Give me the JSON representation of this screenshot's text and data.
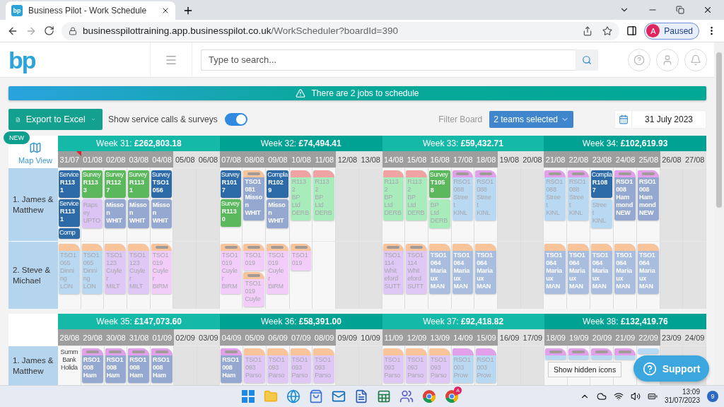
{
  "browser": {
    "tab_title": "Business Pilot - Work Schedule",
    "favicon": "bp",
    "url_host": "businesspilottraining.app.businesspilot.co.uk",
    "url_path": "/WorkScheduler?boardId=390",
    "profile_initial": "A",
    "profile_status": "Paused"
  },
  "header": {
    "logo": "bp",
    "search_placeholder": "Type to search..."
  },
  "banner": {
    "text": "There are 2 jobs to schedule"
  },
  "toolbar": {
    "export_label": "Export to Excel",
    "toggle_label": "Show service calls & surveys",
    "toggle_on": true,
    "filter_label": "Filter Board",
    "filter_value": "2 teams selected",
    "date_value": "31 July 2023"
  },
  "map_view": {
    "badge": "NEW",
    "label": "Map View"
  },
  "blocks": [
    {
      "weeks": [
        {
          "title": "Week 31: **£262,803.18**",
          "days": [
            {
              "date": "31/07",
              "weekend": false,
              "flag": true
            },
            {
              "date": "01/08",
              "weekend": false
            },
            {
              "date": "02/08",
              "weekend": false
            },
            {
              "date": "03/08",
              "weekend": false
            },
            {
              "date": "04/08",
              "weekend": false
            },
            {
              "date": "05/08",
              "weekend": true
            },
            {
              "date": "06/08",
              "weekend": true
            }
          ]
        },
        {
          "title": "Week 32: **£74,494.41**",
          "days": [
            {
              "date": "07/08",
              "weekend": false
            },
            {
              "date": "08/08",
              "weekend": false
            },
            {
              "date": "09/08",
              "weekend": false
            },
            {
              "date": "10/08",
              "weekend": false
            },
            {
              "date": "11/08",
              "weekend": false
            },
            {
              "date": "12/08",
              "weekend": true
            },
            {
              "date": "13/08",
              "weekend": true
            }
          ]
        },
        {
          "title": "Week 33: **£59,432.71**",
          "days": [
            {
              "date": "14/08",
              "weekend": false
            },
            {
              "date": "15/08",
              "weekend": false
            },
            {
              "date": "16/08",
              "weekend": false
            },
            {
              "date": "17/08",
              "weekend": false
            },
            {
              "date": "18/08",
              "weekend": false
            },
            {
              "date": "19/08",
              "weekend": true
            },
            {
              "date": "20/08",
              "weekend": true
            }
          ]
        },
        {
          "title": "Week 34: **£102,619.93**",
          "days": [
            {
              "date": "21/08",
              "weekend": false
            },
            {
              "date": "22/08",
              "weekend": false
            },
            {
              "date": "23/08",
              "weekend": false
            },
            {
              "date": "24/08",
              "weekend": false
            },
            {
              "date": "25/08",
              "weekend": false
            },
            {
              "date": "26/08",
              "weekend": true
            },
            {
              "date": "27/08",
              "weekend": true
            }
          ]
        }
      ],
      "teams": [
        {
          "name": "1. James & Matthew",
          "cells": [
            [
              {
                "kind": "label",
                "color": "#2d6aa8",
                "lines": [
                  "Service",
                  "R113",
                  "1"
                ]
              },
              {
                "kind": "label",
                "color": "#2d6aa8",
                "lines": [
                  "Service",
                  "R113",
                  "1"
                ]
              },
              {
                "kind": "label",
                "color": "#2d6aa8",
                "lines": [
                  "Comp"
                ]
              }
            ],
            [
              {
                "kind": "label",
                "color": "#5cb85c",
                "lines": [
                  "Survey",
                  "R113",
                  "3"
                ]
              },
              {
                "kind": "plain",
                "color": "#dcc4f4",
                "bold": false,
                "lines": [
                  "Raps",
                  "ey",
                  "UPTO"
                ]
              }
            ],
            [
              {
                "kind": "label",
                "color": "#5cb85c",
                "lines": [
                  "Survey",
                  "R112",
                  "7"
                ]
              },
              {
                "kind": "plain",
                "color": "#95a8cf",
                "bold": true,
                "lines": [
                  "Misso",
                  "n",
                  "WHIT"
                ]
              }
            ],
            [
              {
                "kind": "label",
                "color": "#5cb85c",
                "lines": [
                  "Survey",
                  "R113",
                  "1"
                ]
              },
              {
                "kind": "plain",
                "color": "#95a8cf",
                "bold": true,
                "lines": [
                  "Misso",
                  "n",
                  "WHIT"
                ]
              }
            ],
            [
              {
                "kind": "label",
                "color": "#2d6aa8",
                "lines": [
                  "Survey",
                  "TSO1",
                  "056"
                ]
              },
              {
                "kind": "plain",
                "color": "#95a8cf",
                "bold": true,
                "lines": [
                  "Misso",
                  "n",
                  "WHIT"
                ]
              }
            ],
            [],
            [],
            [
              {
                "kind": "label",
                "color": "#2d6aa8",
                "lines": [
                  "Survey",
                  "R101",
                  "7"
                ]
              },
              {
                "kind": "label",
                "color": "#5cb85c",
                "lines": [
                  "Survey",
                  "R113",
                  "0"
                ]
              }
            ],
            [
              {
                "kind": "tab",
                "tab": {
                  "color": "#f9c49a",
                  "handle": true
                },
                "color": "#95a8cf",
                "bold": true,
                "lines": [
                  "TSO1",
                  "081",
                  "Misso",
                  "n",
                  "WHIT"
                ]
              }
            ],
            [
              {
                "kind": "label",
                "color": "#2d6aa8",
                "lines": [
                  "Compla",
                  "R102",
                  "9"
                ]
              },
              {
                "kind": "plain",
                "color": "#95a8cf",
                "bold": true,
                "lines": [
                  "Misso",
                  "n",
                  "WHIT"
                ]
              }
            ],
            [
              {
                "kind": "tab",
                "tab": {
                  "color": "#f0a3a3",
                  "handle": false
                },
                "color": "#a9ecbb",
                "bold": false,
                "lines": [
                  "R113",
                  "2",
                  "BP",
                  "Ltd",
                  "DERB"
                ]
              }
            ],
            [
              {
                "kind": "tab",
                "tab": {
                  "color": "#f0a3a3",
                  "handle": false
                },
                "color": "#a9ecbb",
                "bold": false,
                "lines": [
                  "R113",
                  "2",
                  "BP",
                  "Ltd",
                  "DERB"
                ]
              }
            ],
            [],
            [],
            [
              {
                "kind": "tab",
                "tab": {
                  "color": "#f0a3a3",
                  "handle": false
                },
                "color": "#a9ecbb",
                "bold": false,
                "lines": [
                  "R113",
                  "2",
                  "BP",
                  "Ltd",
                  "DERB"
                ]
              }
            ],
            [
              {
                "kind": "tab",
                "tab": {
                  "color": "#f0a3a3",
                  "handle": false
                },
                "color": "#a9ecbb",
                "bold": false,
                "lines": [
                  "R113",
                  "2",
                  "BP",
                  "Ltd",
                  "DERB"
                ]
              }
            ],
            [
              {
                "kind": "label",
                "color": "#5cb85c",
                "lines": [
                  "Survey",
                  "T105",
                  "8"
                ]
              },
              {
                "kind": "plain",
                "color": "#a9ecbb",
                "bold": false,
                "lines": [
                  "BP",
                  "Ltd",
                  "DERB"
                ]
              }
            ],
            [
              {
                "kind": "tab",
                "tab": {
                  "color": "#e3a0ea",
                  "handle": true
                },
                "color": "#b9d9f2",
                "bold": false,
                "lines": [
                  "RSO1",
                  "088",
                  "Stree",
                  "t",
                  "KINL"
                ]
              }
            ],
            [
              {
                "kind": "tab",
                "tab": {
                  "color": "#e3a0ea",
                  "handle": true
                },
                "color": "#b9d9f2",
                "bold": false,
                "lines": [
                  "RSO1",
                  "088",
                  "Stree",
                  "t",
                  "KINL"
                ]
              }
            ],
            [],
            [],
            [
              {
                "kind": "tab",
                "tab": {
                  "color": "#e3a0ea",
                  "handle": true
                },
                "color": "#b9d9f2",
                "bold": false,
                "lines": [
                  "RSO1",
                  "088",
                  "Stree",
                  "t",
                  "KINL"
                ]
              }
            ],
            [
              {
                "kind": "tab",
                "tab": {
                  "color": "#e3a0ea",
                  "handle": true
                },
                "color": "#b9d9f2",
                "bold": false,
                "lines": [
                  "RSO1",
                  "088",
                  "Stree",
                  "t",
                  "KINL"
                ]
              }
            ],
            [
              {
                "kind": "label",
                "color": "#2d6aa8",
                "lines": [
                  "Compla",
                  "R108",
                  "7"
                ]
              },
              {
                "kind": "plain",
                "color": "#b9d9f2",
                "bold": false,
                "lines": [
                  "Stree",
                  "t",
                  "KINL"
                ]
              }
            ],
            [
              {
                "kind": "tab",
                "tab": {
                  "color": "#e3a0ea",
                  "handle": true
                },
                "color": "#95a8cf",
                "bold": true,
                "lines": [
                  "RSO1",
                  "008",
                  "Ham",
                  "mond",
                  "NEW"
                ]
              }
            ],
            [
              {
                "kind": "tab",
                "tab": {
                  "color": "#e3a0ea",
                  "handle": true
                },
                "color": "#95a8cf",
                "bold": true,
                "lines": [
                  "RSO1",
                  "008",
                  "Ham",
                  "mond",
                  "NEW"
                ]
              }
            ],
            [],
            []
          ]
        },
        {
          "name": "2. Steve & Michael",
          "cells": [
            [
              {
                "kind": "tab",
                "tab": {
                  "color": "#f9c49a",
                  "handle": false
                },
                "color": "#b9d9f2",
                "bold": false,
                "lines": [
                  "TSO1",
                  "065",
                  "Dinni",
                  "ng",
                  "LON"
                ]
              }
            ],
            [
              {
                "kind": "tab",
                "tab": {
                  "color": "#f9c49a",
                  "handle": false
                },
                "color": "#b9d9f2",
                "bold": false,
                "lines": [
                  "TSO1",
                  "065",
                  "Dinni",
                  "ng",
                  "LON"
                ]
              }
            ],
            [
              {
                "kind": "tab",
                "tab": {
                  "color": "#f9c49a",
                  "handle": false
                },
                "color": "#e0c8f6",
                "bold": false,
                "lines": [
                  "TSO1",
                  "123",
                  "Cuyle",
                  "r",
                  "MILT"
                ]
              }
            ],
            [
              {
                "kind": "tab",
                "tab": {
                  "color": "#f9c49a",
                  "handle": false
                },
                "color": "#e0c8f6",
                "bold": false,
                "lines": [
                  "TSO1",
                  "123",
                  "Cuyle",
                  "r",
                  "MILT"
                ]
              }
            ],
            [
              {
                "kind": "tab",
                "tab": {
                  "color": "#f9c49a",
                  "handle": true
                },
                "color": "#f2cdf9",
                "bold": false,
                "lines": [
                  "TSO1",
                  "019",
                  "Cuyle",
                  "r",
                  "BIRM"
                ]
              }
            ],
            [],
            [],
            [
              {
                "kind": "tab",
                "tab": {
                  "color": "#f9c49a",
                  "handle": true
                },
                "color": "#f2cdf9",
                "bold": false,
                "lines": [
                  "TSO1",
                  "019",
                  "Cuyle",
                  "r",
                  "BIRM"
                ]
              }
            ],
            [
              {
                "kind": "tab",
                "tab": {
                  "color": "#f9c49a",
                  "handle": true
                },
                "color": "#f2cdf9",
                "bold": false,
                "lines": [
                  "TSO1",
                  "019"
                ]
              },
              {
                "kind": "tab",
                "tab": {
                  "color": "#f9c49a",
                  "handle": true
                },
                "color": "#f2cdf9",
                "bold": false,
                "lines": [
                  "TSO1",
                  "019",
                  "Cuyle"
                ]
              }
            ],
            [
              {
                "kind": "tab",
                "tab": {
                  "color": "#f9c49a",
                  "handle": true
                },
                "color": "#f2cdf9",
                "bold": false,
                "lines": [
                  "TSO1",
                  "019",
                  "Cuyle",
                  "r",
                  "BIRM"
                ]
              }
            ],
            [
              {
                "kind": "tab",
                "tab": {
                  "color": "#f9c49a",
                  "handle": true
                },
                "color": "#f2cdf9",
                "bold": false,
                "lines": [
                  "TSO1",
                  "019"
                ]
              }
            ],
            [],
            [],
            [],
            [
              {
                "kind": "tab",
                "tab": {
                  "color": "#f9c49a",
                  "handle": true
                },
                "color": "#e0c8f6",
                "bold": false,
                "lines": [
                  "TSO1",
                  "114",
                  "Whit",
                  "eford",
                  "SUTT"
                ]
              }
            ],
            [
              {
                "kind": "tab",
                "tab": {
                  "color": "#f9c49a",
                  "handle": true
                },
                "color": "#e0c8f6",
                "bold": false,
                "lines": [
                  "TSO1",
                  "114",
                  "Whit",
                  "eford",
                  "SUTT"
                ]
              }
            ],
            [
              {
                "kind": "tab",
                "tab": {
                  "color": "#f9c49a",
                  "handle": false
                },
                "color": "#a9bedf",
                "bold": true,
                "lines": [
                  "TSO1",
                  "064",
                  "Maria",
                  "ux",
                  "MAN"
                ]
              }
            ],
            [
              {
                "kind": "tab",
                "tab": {
                  "color": "#f9c49a",
                  "handle": false
                },
                "color": "#a9bedf",
                "bold": true,
                "lines": [
                  "TSO1",
                  "064",
                  "Maria",
                  "ux",
                  "MAN"
                ]
              }
            ],
            [
              {
                "kind": "tab",
                "tab": {
                  "color": "#f9c49a",
                  "handle": false
                },
                "color": "#a9bedf",
                "bold": true,
                "lines": [
                  "TSO1",
                  "064",
                  "Maria",
                  "ux",
                  "MAN"
                ]
              }
            ],
            [],
            [],
            [
              {
                "kind": "tab",
                "tab": {
                  "color": "#f9c49a",
                  "handle": false
                },
                "color": "#a9bedf",
                "bold": true,
                "lines": [
                  "TSO1",
                  "064",
                  "Maria",
                  "ux",
                  "MAN"
                ]
              }
            ],
            [
              {
                "kind": "tab",
                "tab": {
                  "color": "#f9c49a",
                  "handle": false
                },
                "color": "#a9bedf",
                "bold": true,
                "lines": [
                  "TSO1",
                  "064",
                  "Maria",
                  "ux",
                  "MAN"
                ]
              }
            ],
            [
              {
                "kind": "tab",
                "tab": {
                  "color": "#f9c49a",
                  "handle": false
                },
                "color": "#a9bedf",
                "bold": true,
                "lines": [
                  "TSO1",
                  "064",
                  "Maria",
                  "ux",
                  "MAN"
                ]
              }
            ],
            [
              {
                "kind": "tab",
                "tab": {
                  "color": "#f9c49a",
                  "handle": false
                },
                "color": "#a9bedf",
                "bold": true,
                "lines": [
                  "TSO1",
                  "064",
                  "Maria",
                  "ux",
                  "MAN"
                ]
              }
            ],
            [
              {
                "kind": "tab",
                "tab": {
                  "color": "#f9c49a",
                  "handle": false
                },
                "color": "#a9bedf",
                "bold": true,
                "lines": [
                  "TSO1",
                  "064",
                  "Maria",
                  "ux",
                  "MAN"
                ]
              }
            ],
            [],
            []
          ]
        }
      ]
    },
    {
      "weeks": [
        {
          "title": "Week 35: **£147,073.60**",
          "days": [
            {
              "date": "28/08",
              "weekend": false
            },
            {
              "date": "29/08",
              "weekend": false
            },
            {
              "date": "30/08",
              "weekend": false
            },
            {
              "date": "31/08",
              "weekend": false
            },
            {
              "date": "01/09",
              "weekend": false
            },
            {
              "date": "02/09",
              "weekend": true
            },
            {
              "date": "03/09",
              "weekend": true
            }
          ]
        },
        {
          "title": "Week 36: **£58,391.00**",
          "days": [
            {
              "date": "04/09",
              "weekend": false
            },
            {
              "date": "05/09",
              "weekend": false
            },
            {
              "date": "06/09",
              "weekend": false
            },
            {
              "date": "07/09",
              "weekend": false
            },
            {
              "date": "08/09",
              "weekend": false
            },
            {
              "date": "09/09",
              "weekend": true
            },
            {
              "date": "10/09",
              "weekend": true
            }
          ]
        },
        {
          "title": "Week 37: **£92,418.82**",
          "days": [
            {
              "date": "11/09",
              "weekend": false
            },
            {
              "date": "12/09",
              "weekend": false
            },
            {
              "date": "13/09",
              "weekend": false
            },
            {
              "date": "14/09",
              "weekend": false
            },
            {
              "date": "15/09",
              "weekend": false
            },
            {
              "date": "16/09",
              "weekend": true
            },
            {
              "date": "17/09",
              "weekend": true
            }
          ]
        },
        {
          "title": "Week 38: **£132,419.76**",
          "days": [
            {
              "date": "18/09",
              "weekend": false
            },
            {
              "date": "19/09",
              "weekend": false
            },
            {
              "date": "20/09",
              "weekend": false
            },
            {
              "date": "21/09",
              "weekend": false
            },
            {
              "date": "22/09",
              "weekend": false
            },
            {
              "date": "23/09",
              "weekend": true
            },
            {
              "date": "24/09",
              "weekend": true
            }
          ]
        }
      ],
      "teams": [
        {
          "name": "1. James & Matthew",
          "cells": [
            [
              {
                "kind": "note",
                "lines": [
                  "Summ",
                  "Bank",
                  "Holida"
                ]
              }
            ],
            [
              {
                "kind": "tab",
                "tab": {
                  "color": "#e3a0ea",
                  "handle": true
                },
                "color": "#95a8cf",
                "bold": true,
                "lines": [
                  "RSO1",
                  "008",
                  "Ham"
                ]
              }
            ],
            [
              {
                "kind": "tab",
                "tab": {
                  "color": "#e3a0ea",
                  "handle": true
                },
                "color": "#95a8cf",
                "bold": true,
                "lines": [
                  "RSO1",
                  "008",
                  "Ham"
                ]
              }
            ],
            [
              {
                "kind": "tab",
                "tab": {
                  "color": "#e3a0ea",
                  "handle": true
                },
                "color": "#95a8cf",
                "bold": true,
                "lines": [
                  "RSO1",
                  "008",
                  "Ham"
                ]
              }
            ],
            [
              {
                "kind": "tab",
                "tab": {
                  "color": "#e3a0ea",
                  "handle": true
                },
                "color": "#95a8cf",
                "bold": true,
                "lines": [
                  "RSO1",
                  "008",
                  "Ham"
                ]
              }
            ],
            [],
            [],
            [
              {
                "kind": "tab",
                "tab": {
                  "color": "#e3a0ea",
                  "handle": true
                },
                "color": "#95a8cf",
                "bold": true,
                "lines": [
                  "RSO1",
                  "008",
                  "Ham"
                ]
              }
            ],
            [
              {
                "kind": "tab",
                "tab": {
                  "color": "#f9c49a",
                  "handle": false
                },
                "color": "#e0c8f6",
                "bold": false,
                "lines": [
                  "TSO1",
                  "093",
                  "Parso"
                ]
              }
            ],
            [
              {
                "kind": "tab",
                "tab": {
                  "color": "#f9c49a",
                  "handle": false
                },
                "color": "#e0c8f6",
                "bold": false,
                "lines": [
                  "TSO1",
                  "093",
                  "Parso"
                ]
              }
            ],
            [
              {
                "kind": "tab",
                "tab": {
                  "color": "#f9c49a",
                  "handle": false
                },
                "color": "#e0c8f6",
                "bold": false,
                "lines": [
                  "TSO1",
                  "093",
                  "Parso"
                ]
              }
            ],
            [
              {
                "kind": "tab",
                "tab": {
                  "color": "#f9c49a",
                  "handle": false
                },
                "color": "#e0c8f6",
                "bold": false,
                "lines": [
                  "TSO1",
                  "093",
                  "Parso"
                ]
              }
            ],
            [],
            [],
            [
              {
                "kind": "tab",
                "tab": {
                  "color": "#f9c49a",
                  "handle": false
                },
                "color": "#e0c8f6",
                "bold": false,
                "lines": [
                  "TSO1",
                  "093",
                  "Parso"
                ]
              }
            ],
            [
              {
                "kind": "tab",
                "tab": {
                  "color": "#f9c49a",
                  "handle": false
                },
                "color": "#e0c8f6",
                "bold": false,
                "lines": [
                  "TSO1",
                  "093",
                  "Parso"
                ]
              }
            ],
            [
              {
                "kind": "tab",
                "tab": {
                  "color": "#f9c49a",
                  "handle": false
                },
                "color": "#e0c8f6",
                "bold": false,
                "lines": [
                  "TSO1",
                  "093",
                  "Parso"
                ]
              }
            ],
            [
              {
                "kind": "tab",
                "tab": {
                  "color": "#e3a0ea",
                  "handle": false
                },
                "color": "#b9d9f2",
                "bold": false,
                "lines": [
                  "RSO1",
                  "003",
                  "Prow"
                ]
              }
            ],
            [
              {
                "kind": "tab",
                "tab": {
                  "color": "#e3a0ea",
                  "handle": false
                },
                "color": "#b9d9f2",
                "bold": false,
                "lines": [
                  "RSO1",
                  "003",
                  "Prow"
                ]
              }
            ],
            [],
            [],
            [
              {
                "kind": "tab",
                "tab": {
                  "color": "#e3a0ea",
                  "handle": true
                },
                "color": "#b9d9f2"
              }
            ],
            [
              {
                "kind": "tab",
                "tab": {
                  "color": "#e3a0ea",
                  "handle": true
                },
                "color": "#b9d9f2"
              }
            ],
            [
              {
                "kind": "tab",
                "tab": {
                  "color": "#e3a0ea",
                  "handle": true
                },
                "color": "#b9d9f2"
              }
            ],
            [
              {
                "kind": "tab",
                "tab": {
                  "color": "#e3a0ea",
                  "handle": true
                },
                "color": "#b9d9f2"
              }
            ],
            [
              {
                "kind": "plain",
                "color": "#b9d9f2"
              }
            ],
            [],
            []
          ]
        }
      ]
    }
  ],
  "support": {
    "label": "Support"
  },
  "tooltip": {
    "text": "Show hidden icons"
  },
  "taskbar": {
    "time": "13:09",
    "date": "31/07/2023",
    "notifications": "9",
    "chrome_profile": "A"
  }
}
